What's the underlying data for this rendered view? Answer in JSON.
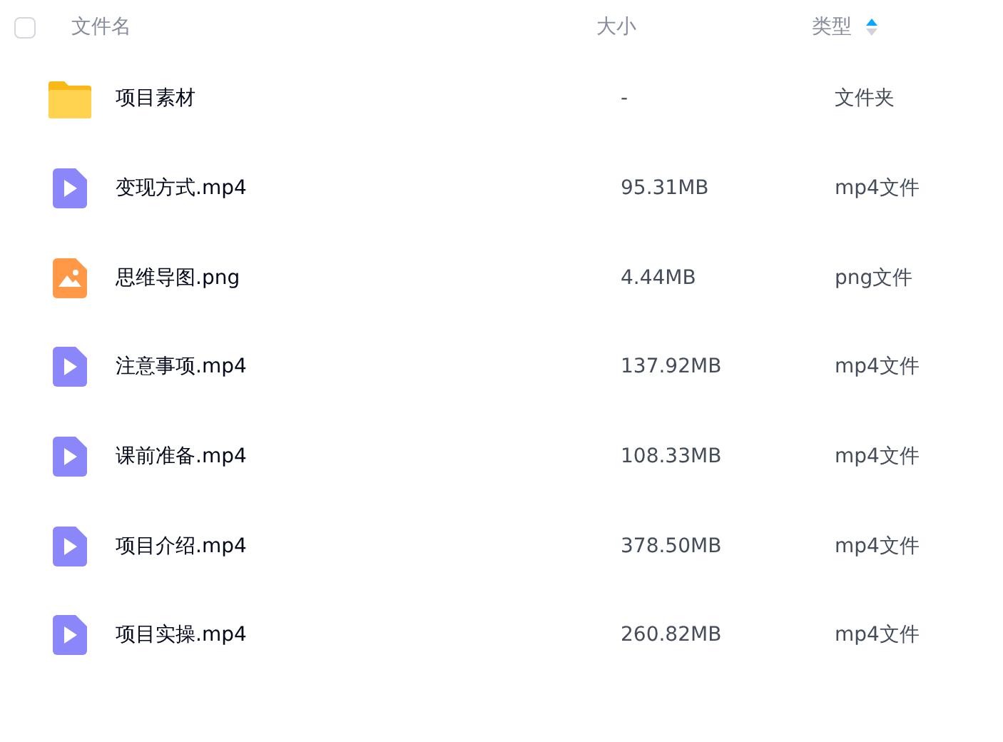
{
  "header": {
    "checked": false,
    "columns": [
      {
        "label": "文件名"
      },
      {
        "label": "大小"
      },
      {
        "label": "类型",
        "sorted_ascending": true
      }
    ]
  },
  "rows": [
    {
      "kind": "folder",
      "name": "项目素材",
      "size": "-",
      "type": "文件夹"
    },
    {
      "kind": "video",
      "name": "变现方式.mp4",
      "size": "95.31MB",
      "type": "mp4文件"
    },
    {
      "kind": "image",
      "name": "思维导图.png",
      "size": "4.44MB",
      "type": "png文件"
    },
    {
      "kind": "video",
      "name": "注意事项.mp4",
      "size": "137.92MB",
      "type": "mp4文件"
    },
    {
      "kind": "video",
      "name": "课前准备.mp4",
      "size": "108.33MB",
      "type": "mp4文件"
    },
    {
      "kind": "video",
      "name": "项目介绍.mp4",
      "size": "378.50MB",
      "type": "mp4文件"
    },
    {
      "kind": "video",
      "name": "项目实操.mp4",
      "size": "260.82MB",
      "type": "mp4文件"
    }
  ]
}
